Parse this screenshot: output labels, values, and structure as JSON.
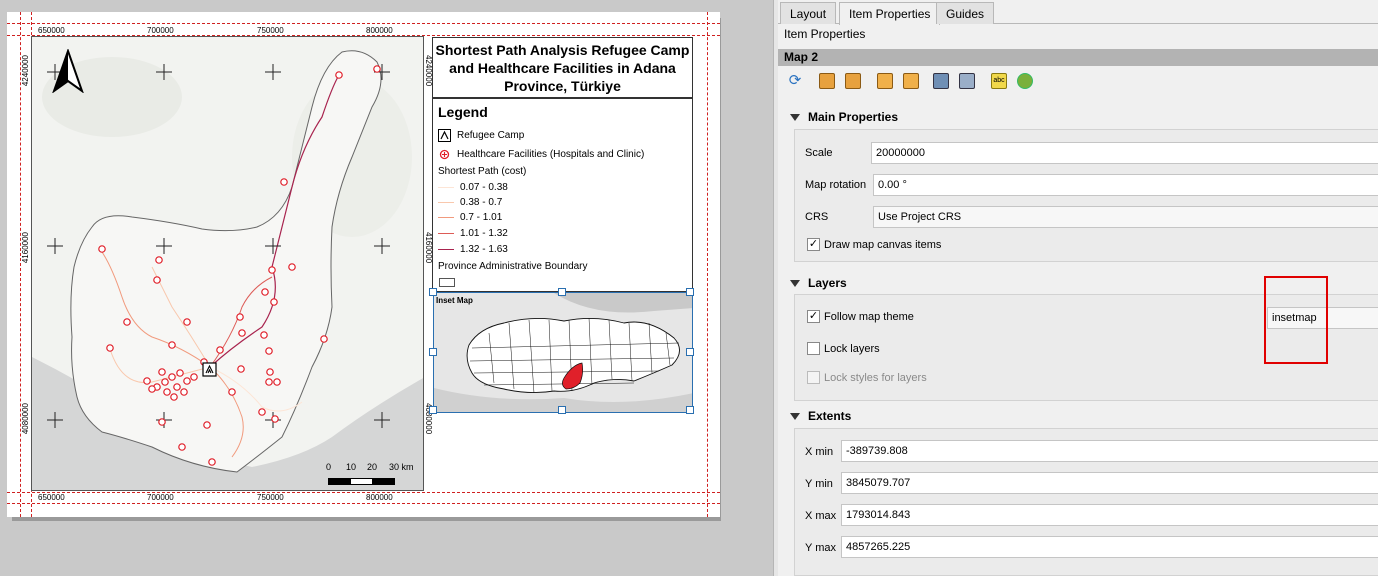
{
  "layout": {
    "title": "Shortest Path Analysis Refugee Camp and Healthcare Facilities in Adana Province, Türkiye",
    "coords": {
      "x_ticks": [
        "650000",
        "700000",
        "750000",
        "800000"
      ],
      "y_ticks": [
        "4240000",
        "4160000",
        "4080000"
      ]
    },
    "scalebar": {
      "labels": [
        "0",
        "10",
        "20",
        "30 km"
      ]
    },
    "legend": {
      "title": "Legend",
      "items": [
        {
          "label": "Refugee Camp",
          "symbol": "camp-icon"
        },
        {
          "label": "Healthcare Facilities (Hospitals and Clinic)",
          "symbol": "health-icon"
        }
      ],
      "path_header": "Shortest Path (cost)",
      "path_classes": [
        {
          "label": "0.07 - 0.38",
          "color": "#fde5d6"
        },
        {
          "label": "0.38 - 0.7",
          "color": "#f9c8ad"
        },
        {
          "label": "0.7 - 1.01",
          "color": "#f19a7d"
        },
        {
          "label": "1.01 - 1.32",
          "color": "#dd5b56"
        },
        {
          "label": "1.32 - 1.63",
          "color": "#a8234e"
        }
      ],
      "boundary_label": "Province Administrative Boundary"
    },
    "inset": {
      "title": "Inset Map"
    }
  },
  "dock": {
    "tabs": [
      "Layout",
      "Item Properties",
      "Guides"
    ],
    "active_tab": "Item Properties",
    "panel_title": "Item Properties",
    "item_name": "Map 2",
    "main_properties": {
      "header": "Main Properties",
      "scale_label": "Scale",
      "scale_value": "20000000",
      "rotation_label": "Map rotation",
      "rotation_value": "0.00 °",
      "crs_label": "CRS",
      "crs_value": "Use Project CRS",
      "draw_items_label": "Draw map canvas items",
      "draw_items_checked": true
    },
    "layers": {
      "header": "Layers",
      "follow_theme_label": "Follow map theme",
      "follow_theme_checked": true,
      "theme_value": "insetmap",
      "lock_layers_label": "Lock layers",
      "lock_styles_label": "Lock styles for layers"
    },
    "extents": {
      "header": "Extents",
      "xmin_label": "X min",
      "xmin_value": "-389739.808",
      "ymin_label": "Y min",
      "ymin_value": "3845079.707",
      "xmax_label": "X max",
      "xmax_value": "1793014.843",
      "ymax_label": "Y max",
      "ymax_value": "4857265.225"
    }
  },
  "colors": {
    "guide": "#d02020",
    "highlight": "#e00000",
    "health": "#e0202a",
    "province_fill": "#e0202a"
  }
}
